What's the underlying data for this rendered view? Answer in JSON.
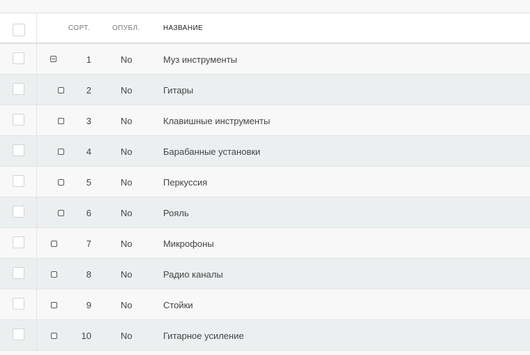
{
  "header": {
    "sort": "СОРТ.",
    "published": "ОПУБЛ.",
    "name": "НАЗВАНИЕ"
  },
  "rows": [
    {
      "sort": "1",
      "published": "No",
      "name": "Муз инструменты",
      "tree": "collapse",
      "level": 0
    },
    {
      "sort": "2",
      "published": "No",
      "name": "Гитары",
      "tree": "leaf",
      "level": 2
    },
    {
      "sort": "3",
      "published": "No",
      "name": "Клавишные инструменты",
      "tree": "leaf",
      "level": 2
    },
    {
      "sort": "4",
      "published": "No",
      "name": "Барабанные установки",
      "tree": "leaf",
      "level": 2
    },
    {
      "sort": "5",
      "published": "No",
      "name": "Перкуссия",
      "tree": "leaf",
      "level": 2
    },
    {
      "sort": "6",
      "published": "No",
      "name": "Рояль",
      "tree": "leaf",
      "level": 2
    },
    {
      "sort": "7",
      "published": "No",
      "name": "Микрофоны",
      "tree": "leaf",
      "level": 1
    },
    {
      "sort": "8",
      "published": "No",
      "name": "Радио каналы",
      "tree": "leaf",
      "level": 1
    },
    {
      "sort": "9",
      "published": "No",
      "name": "Стойки",
      "tree": "leaf",
      "level": 1
    },
    {
      "sort": "10",
      "published": "No",
      "name": "Гитарное усиление",
      "tree": "leaf",
      "level": 1
    }
  ]
}
